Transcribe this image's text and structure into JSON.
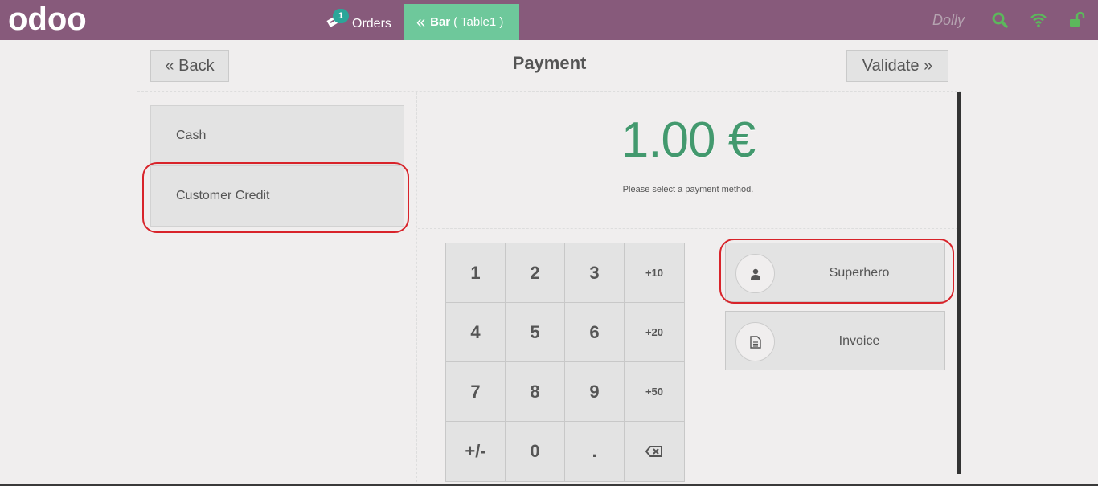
{
  "colors": {
    "topbar": "#875a7b",
    "accent_green": "#6ec89b",
    "amount_green": "#43996e",
    "badge_teal": "#2ba699",
    "highlight_red": "#d8232a",
    "status_icon_green": "#5cb85c"
  },
  "topbar": {
    "logo_text": "odoo",
    "orders": {
      "badge": "1",
      "label": "Orders",
      "icon": "ticket-icon"
    },
    "active_order": {
      "icon": "double-chevron-left-icon",
      "name": "Bar",
      "detail": "( Table1 )"
    },
    "user": "Dolly",
    "icons": [
      "search-icon",
      "wifi-icon",
      "unlock-icon"
    ]
  },
  "header": {
    "back_label": "« Back",
    "title": "Payment",
    "validate_label": "Validate »"
  },
  "payment_methods": [
    {
      "label": "Cash"
    },
    {
      "label": "Customer Credit"
    }
  ],
  "payment": {
    "amount": "1.00 €",
    "hint": "Please select a payment method."
  },
  "numpad": {
    "keys": [
      "1",
      "2",
      "3",
      "+10",
      "4",
      "5",
      "6",
      "+20",
      "7",
      "8",
      "9",
      "+50",
      "+/-",
      "0",
      ".",
      "⌫"
    ]
  },
  "side_buttons": {
    "customer": {
      "label": "Superhero",
      "icon": "user-icon"
    },
    "invoice": {
      "label": "Invoice",
      "icon": "document-icon"
    }
  }
}
